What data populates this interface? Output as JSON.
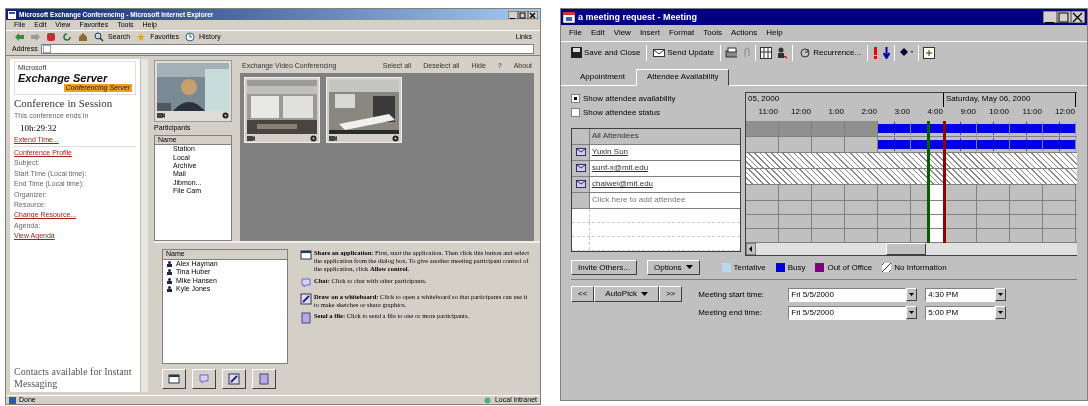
{
  "left_window": {
    "title": "Microsoft Exchange Conferencing - Microsoft Internet Explorer",
    "menu": [
      "File",
      "Edit",
      "View",
      "Favorites",
      "Tools",
      "Help"
    ],
    "toolbar": [
      {
        "kind": "back"
      },
      {
        "kind": "forward"
      },
      {
        "kind": "stop"
      },
      {
        "kind": "refresh"
      },
      {
        "kind": "home"
      },
      {
        "kind": "search",
        "label": "Search"
      },
      {
        "kind": "favorites",
        "label": "Favorites"
      },
      {
        "kind": "history",
        "label": "History"
      }
    ],
    "links_label": "Links",
    "address_label": "Address",
    "sidebar": {
      "logo": {
        "top": "Microsoft",
        "main": "Exchange Server",
        "sub": "Conferencing Server"
      },
      "heading": "Conference in Session",
      "items": [
        {
          "kind": "text",
          "text": "This conference ends in"
        },
        {
          "kind": "time",
          "text": "10h:29:32"
        },
        {
          "kind": "link",
          "text": "Extend Time..."
        },
        {
          "kind": "rule"
        },
        {
          "kind": "link",
          "text": "Conference Profile"
        },
        {
          "kind": "label",
          "text": "Subject:"
        },
        {
          "kind": "label",
          "text": "Start Time (Local time):"
        },
        {
          "kind": "label",
          "text": "End Time (Local time):"
        },
        {
          "kind": "label",
          "text": "Organizer:"
        },
        {
          "kind": "label",
          "text": "Resource:"
        },
        {
          "kind": "link",
          "text": "Change Resource..."
        },
        {
          "kind": "label",
          "text": "Agenda:"
        },
        {
          "kind": "link",
          "text": "View Agenda"
        }
      ],
      "contacts_heading": "Contacts available for Instant Messaging"
    },
    "participants": {
      "label": "Participants",
      "header": "Name",
      "items": [
        "Station",
        "Local",
        "Archive",
        "Mail",
        "Jibmon...",
        "File Cam"
      ]
    },
    "video_header": "Exchange Video Conferencing",
    "video_actions": [
      "Select all",
      "Deselect all",
      "Hide",
      "?",
      "About"
    ],
    "video_tiles": [
      {
        "kind": "picture"
      },
      {
        "kind": "picture"
      }
    ],
    "people": {
      "header": "Name",
      "items": [
        "Alex Hayman",
        "Tina Huber",
        "Mike Hansen",
        "Kyle Jones"
      ]
    },
    "tools": [
      {
        "kind": "share",
        "text": "**Share an application:** First, start the application. Then click this button and select the application from the dialog box. To give another meeting participant control of the application, click **Allow control**."
      },
      {
        "kind": "chat",
        "text": "**Chat:** Click to chat with other participants."
      },
      {
        "kind": "whiteboard",
        "text": "**Draw on a whiteboard:** Click to open a whiteboard so that participants can use it to make sketches or share graphics."
      },
      {
        "kind": "file",
        "text": "**Send a file:** Click to send a file to one or more participants."
      }
    ],
    "status": {
      "text": "Done",
      "zone": "Local intranet"
    }
  },
  "right_window": {
    "title": "a meeting request - Meeting",
    "menu": [
      "File",
      "Edit",
      "View",
      "Insert",
      "Format",
      "Tools",
      "Actions",
      "Help"
    ],
    "toolbar": [
      {
        "kind": "save",
        "label": "Save and Close"
      },
      {
        "kind": "send",
        "label": "Send Update"
      },
      {
        "kind": "print"
      },
      {
        "kind": "clip"
      },
      {
        "kind": "planner"
      },
      {
        "kind": "invite"
      },
      {
        "kind": "recur",
        "label": "Recurrence..."
      },
      {
        "kind": "high"
      },
      {
        "kind": "low"
      },
      {
        "kind": "nav"
      },
      {
        "kind": "form"
      }
    ],
    "tabs": [
      {
        "label": "Appointment",
        "selected": false
      },
      {
        "label": "Attendee Availability",
        "selected": true
      }
    ],
    "options": [
      {
        "label": "Show attendee availability",
        "selected": true
      },
      {
        "label": "Show attendee status",
        "selected": false
      }
    ],
    "days": [
      {
        "label": "05, 2000",
        "hours": [
          "11:00",
          "12:00",
          "1:00",
          "2:00",
          "3:00",
          "4:00"
        ]
      },
      {
        "label": "Saturday, May 06, 2000",
        "hours": [
          "9:00",
          "10:00",
          "11:00",
          "12:00"
        ]
      }
    ],
    "slots": [
      {
        "selected": false
      },
      {
        "selected": false
      },
      {
        "selected": false
      },
      {
        "selected": false
      },
      {
        "selected": false
      },
      {
        "selected": false
      },
      {
        "selected": false
      },
      {
        "selected": false
      },
      {
        "selected": false
      },
      {
        "selected": false
      },
      {
        "selected": false
      },
      {
        "selected": true
      },
      {
        "selected": false
      },
      {
        "selected": false
      },
      {
        "selected": false
      },
      {
        "selected": false
      },
      {
        "selected": false
      },
      {
        "selected": false
      },
      {
        "selected": false
      },
      {
        "selected": false
      }
    ],
    "attendees": [
      {
        "kind": "all",
        "name": "All Attendees",
        "slots": [
          {
            "busy": false
          },
          {
            "busy": false
          },
          {
            "busy": false
          },
          {
            "busy": false
          },
          {
            "busy": false
          },
          {
            "busy": false
          },
          {
            "busy": false
          },
          {
            "busy": false
          },
          {
            "busy": true
          },
          {
            "busy": true
          },
          {
            "busy": true
          },
          {
            "busy": true
          },
          {
            "busy": true
          },
          {
            "busy": true
          },
          {
            "busy": true
          },
          {
            "busy": true
          },
          {
            "busy": true
          },
          {
            "busy": true
          },
          {
            "busy": true
          },
          {
            "busy": true
          }
        ]
      },
      {
        "kind": "person",
        "name": "Yuxin Sun",
        "slots": [
          {
            "busy": false
          },
          {
            "busy": false
          },
          {
            "busy": false
          },
          {
            "busy": false
          },
          {
            "busy": false
          },
          {
            "busy": false
          },
          {
            "busy": false
          },
          {
            "busy": false
          },
          {
            "busy": true
          },
          {
            "busy": true
          },
          {
            "busy": true
          },
          {
            "busy": true
          },
          {
            "busy": true
          },
          {
            "busy": true
          },
          {
            "busy": true
          },
          {
            "busy": true
          },
          {
            "busy": true
          },
          {
            "busy": true
          },
          {
            "busy": true
          },
          {
            "busy": true
          }
        ]
      },
      {
        "kind": "unknown",
        "name": "sunf-x@mit.edu"
      },
      {
        "kind": "unknown",
        "name": "chaiwei@mit.edu"
      },
      {
        "kind": "add",
        "placeholder": "Click here to add attendee"
      }
    ],
    "invite_button": "Invite Others...",
    "options_button": "Options",
    "legend": [
      {
        "kind": "tentative",
        "label": "Tentative",
        "color": "#b8d8f0"
      },
      {
        "kind": "busy",
        "label": "Busy",
        "color": "#0000e0"
      },
      {
        "kind": "oof",
        "label": "Out of Office",
        "color": "#800080"
      },
      {
        "kind": "noinfo",
        "label": "No Information"
      }
    ],
    "prev_button": "<<",
    "autopick_button": "AutoPick",
    "next_button": ">>",
    "times": [
      {
        "label": "Meeting start time:",
        "date": "Fri 5/5/2000",
        "time": "4:30 PM"
      },
      {
        "label": "Meeting end time:",
        "date": "Fri 5/5/2000",
        "time": "5:00 PM"
      }
    ]
  }
}
